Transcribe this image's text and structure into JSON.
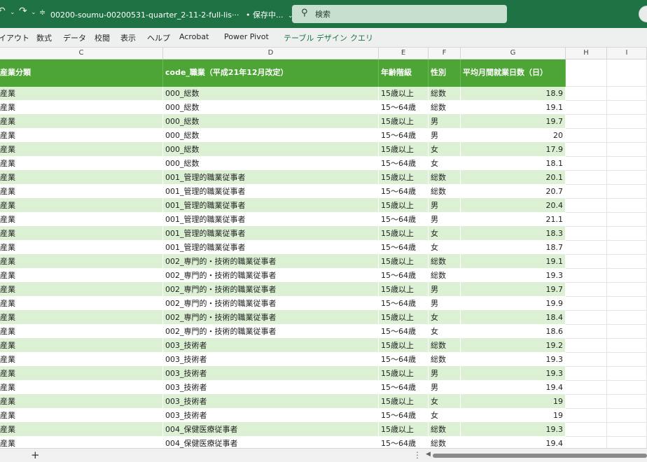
{
  "titlebar": {
    "undo_icon": "undo-icon",
    "redo_icon": "redo-icon",
    "customize_icon": "customize-qat-icon",
    "file_name": "00200-soumu-00200531-quarter_2-11-2-full-lis···",
    "save_status": "• 保存中...",
    "search_placeholder": "検索"
  },
  "ribbon": {
    "tabs": [
      "イアウト",
      "数式",
      "データ",
      "校閲",
      "表示",
      "ヘルプ",
      "Acrobat",
      "Power Pivot",
      "テーブル デザイン",
      "クエリ"
    ]
  },
  "columns": {
    "letters": [
      "C",
      "D",
      "E",
      "F",
      "G",
      "H",
      "I"
    ]
  },
  "table": {
    "headers": [
      "産業分類",
      "code_職業（平成21年12月改定）",
      "年齢階級",
      "性別",
      "平均月間就業日数（日）"
    ],
    "rows": [
      [
        "産業",
        "000_総数",
        "15歳以上",
        "総数",
        "18.9"
      ],
      [
        "産業",
        "000_総数",
        "15～64歳",
        "総数",
        "19.1"
      ],
      [
        "産業",
        "000_総数",
        "15歳以上",
        "男",
        "19.7"
      ],
      [
        "産業",
        "000_総数",
        "15～64歳",
        "男",
        "20"
      ],
      [
        "産業",
        "000_総数",
        "15歳以上",
        "女",
        "17.9"
      ],
      [
        "産業",
        "000_総数",
        "15～64歳",
        "女",
        "18.1"
      ],
      [
        "産業",
        "001_管理的職業従事者",
        "15歳以上",
        "総数",
        "20.1"
      ],
      [
        "産業",
        "001_管理的職業従事者",
        "15～64歳",
        "総数",
        "20.7"
      ],
      [
        "産業",
        "001_管理的職業従事者",
        "15歳以上",
        "男",
        "20.4"
      ],
      [
        "産業",
        "001_管理的職業従事者",
        "15～64歳",
        "男",
        "21.1"
      ],
      [
        "産業",
        "001_管理的職業従事者",
        "15歳以上",
        "女",
        "18.3"
      ],
      [
        "産業",
        "001_管理的職業従事者",
        "15～64歳",
        "女",
        "18.7"
      ],
      [
        "産業",
        "002_専門的・技術的職業従事者",
        "15歳以上",
        "総数",
        "19.1"
      ],
      [
        "産業",
        "002_専門的・技術的職業従事者",
        "15～64歳",
        "総数",
        "19.3"
      ],
      [
        "産業",
        "002_専門的・技術的職業従事者",
        "15歳以上",
        "男",
        "19.7"
      ],
      [
        "産業",
        "002_専門的・技術的職業従事者",
        "15～64歳",
        "男",
        "19.9"
      ],
      [
        "産業",
        "002_専門的・技術的職業従事者",
        "15歳以上",
        "女",
        "18.4"
      ],
      [
        "産業",
        "002_専門的・技術的職業従事者",
        "15～64歳",
        "女",
        "18.6"
      ],
      [
        "産業",
        "003_技術者",
        "15歳以上",
        "総数",
        "19.2"
      ],
      [
        "産業",
        "003_技術者",
        "15～64歳",
        "総数",
        "19.3"
      ],
      [
        "産業",
        "003_技術者",
        "15歳以上",
        "男",
        "19.3"
      ],
      [
        "産業",
        "003_技術者",
        "15～64歳",
        "男",
        "19.4"
      ],
      [
        "産業",
        "003_技術者",
        "15歳以上",
        "女",
        "19"
      ],
      [
        "産業",
        "003_技術者",
        "15～64歳",
        "女",
        "19"
      ],
      [
        "産業",
        "004_保健医療従事者",
        "15歳以上",
        "総数",
        "19.3"
      ],
      [
        "産業",
        "004_保健医療従事者",
        "15～64歳",
        "総数",
        "19.4"
      ]
    ]
  },
  "bottombar": {
    "add_sheet_label": "+",
    "more_label": "⋮",
    "scroll_left_label": "◀"
  },
  "colors": {
    "title_green": "#1f7244",
    "header_green": "#4ca534",
    "band_green": "#dcf1d4"
  }
}
